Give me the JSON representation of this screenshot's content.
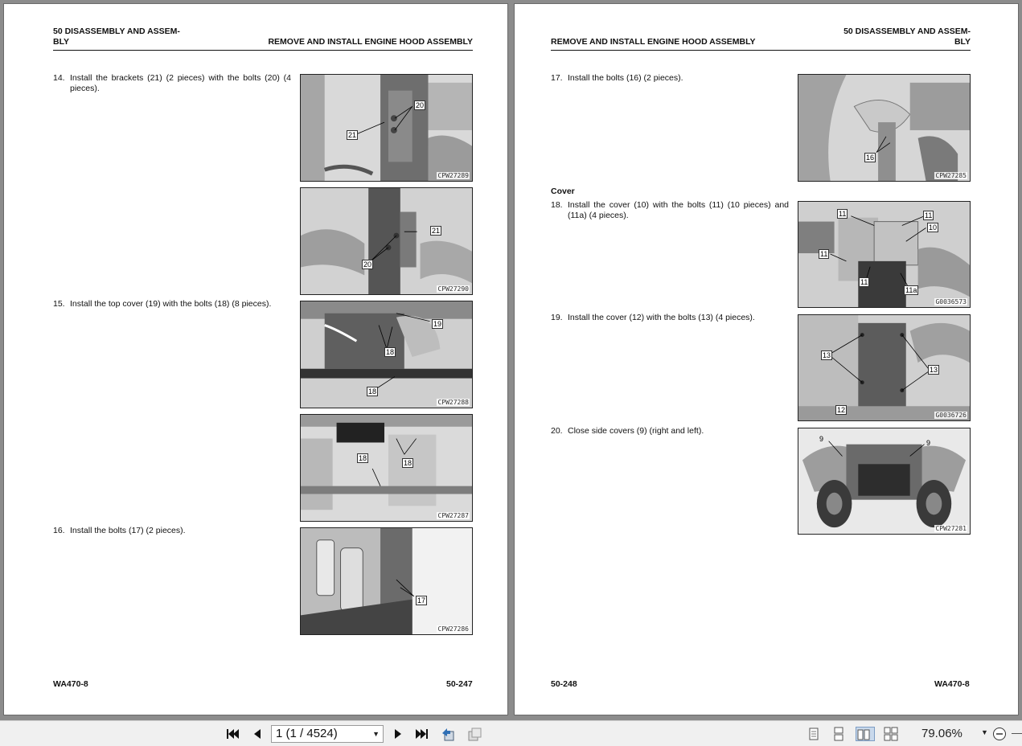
{
  "left_page": {
    "header_section": "50 DISASSEMBLY AND ASSEM-\nBLY",
    "header_title": "REMOVE AND INSTALL ENGINE HOOD ASSEMBLY",
    "steps": [
      {
        "num": "14.",
        "text": "Install the brackets (21) (2 pieces) with the bolts (20) (4 pieces)."
      },
      {
        "num": "15.",
        "text": "Install the top cover (19) with the bolts (18) (8 pieces)."
      },
      {
        "num": "16.",
        "text": "Install the bolts (17) (2 pieces)."
      }
    ],
    "figures": [
      {
        "code": "CPW27289",
        "callouts": [
          "20",
          "21"
        ]
      },
      {
        "code": "CPW27290",
        "callouts": [
          "21",
          "20"
        ]
      },
      {
        "code": "CPW27288",
        "callouts": [
          "19",
          "18",
          "18"
        ]
      },
      {
        "code": "CPW27287",
        "callouts": [
          "18",
          "18"
        ]
      },
      {
        "code": "CPW27286",
        "callouts": [
          "17"
        ]
      }
    ],
    "footer_model": "WA470-8",
    "footer_page": "50-247"
  },
  "right_page": {
    "header_section": "50 DISASSEMBLY AND ASSEM-\nBLY",
    "header_title": "REMOVE AND INSTALL ENGINE HOOD ASSEMBLY",
    "subheading": "Cover",
    "steps": [
      {
        "num": "17.",
        "text": "Install the bolts (16) (2 pieces)."
      },
      {
        "num": "18.",
        "text": "Install the cover (10) with the bolts (11) (10 pieces) and (11a) (4 pieces)."
      },
      {
        "num": "19.",
        "text": "Install the cover (12) with the bolts (13) (4 pieces)."
      },
      {
        "num": "20.",
        "text": "Close side covers (9) (right and left)."
      }
    ],
    "figures": [
      {
        "code": "CPW27285",
        "callouts": [
          "16"
        ]
      },
      {
        "code": "G0036573",
        "callouts": [
          "11",
          "11",
          "10",
          "11",
          "11",
          "11a"
        ]
      },
      {
        "code": "G0036726",
        "callouts": [
          "13",
          "13",
          "12"
        ]
      },
      {
        "code": "CPW27281",
        "callouts": [
          "9",
          "9"
        ]
      }
    ],
    "footer_page": "50-248",
    "footer_model": "WA470-8"
  },
  "toolbar": {
    "page_indicator": "1 (1 / 4524)",
    "zoom": "79.06%",
    "icons": [
      "first-page-icon",
      "prev-page-icon",
      "next-page-icon",
      "last-page-icon",
      "go-back-view-icon",
      "go-forward-view-icon",
      "single-page-view-icon",
      "continuous-view-icon",
      "facing-view-icon",
      "continuous-facing-view-icon",
      "zoom-out-icon"
    ]
  }
}
